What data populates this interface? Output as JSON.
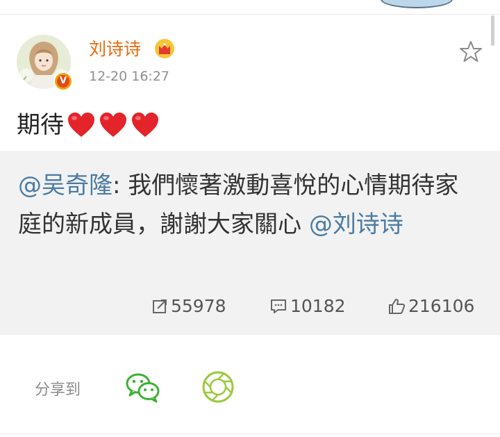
{
  "post": {
    "username": "刘诗诗",
    "timestamp": "12-20 16:27",
    "verified_badge": "V",
    "text": "期待",
    "emoji": [
      "heart",
      "heart",
      "heart"
    ]
  },
  "repost": {
    "author_mention": "@吴奇隆",
    "body": ": 我們懷著激動喜悅的心情期待家庭的新成員，謝謝大家關心 ",
    "end_mention": "@刘诗诗"
  },
  "stats": {
    "reposts": "55978",
    "comments": "10182",
    "likes": "216106"
  },
  "share": {
    "label": "分享到",
    "targets": [
      "wechat-icon",
      "moments-icon"
    ]
  },
  "colors": {
    "username": "#e86b0c",
    "mention": "#4a7ba3",
    "repost_bg": "#f2f2f2",
    "heart": "#e3242b",
    "wechat": "#3cb034",
    "moments": "#9bc93c"
  }
}
